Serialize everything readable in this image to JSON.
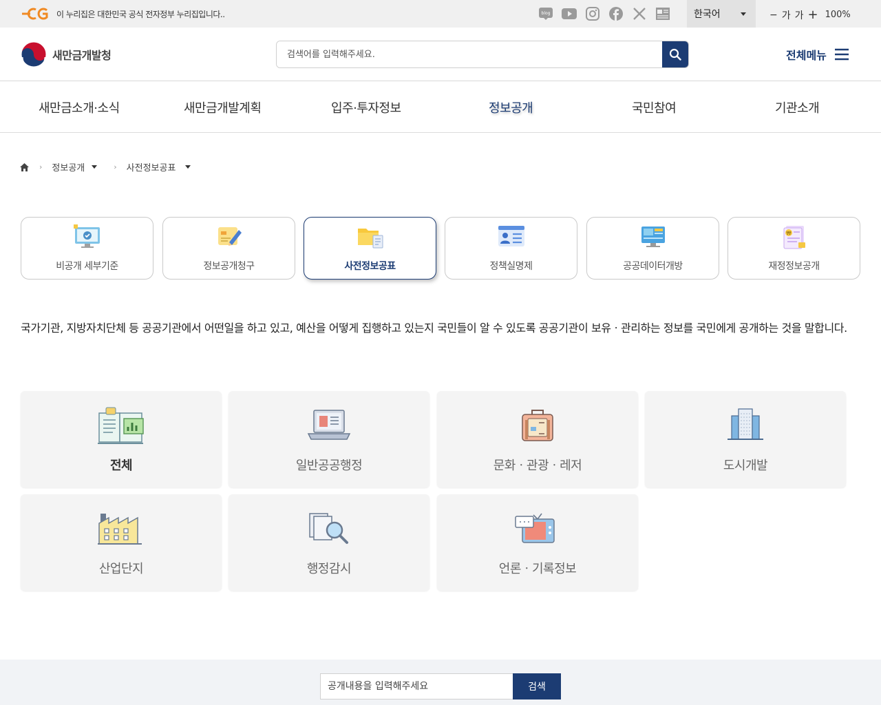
{
  "govbar": {
    "logo_text": "eG",
    "notice": "이 누리집은 대한민국 공식 전자정부 누리집입니다..",
    "sns": [
      {
        "name": "blog-icon",
        "label": "blog"
      },
      {
        "name": "youtube-icon",
        "label": "▶"
      },
      {
        "name": "instagram-icon",
        "label": "◎"
      },
      {
        "name": "facebook-icon",
        "label": "f"
      },
      {
        "name": "x-icon",
        "label": "X"
      },
      {
        "name": "newspaper-icon",
        "label": "▤"
      }
    ],
    "language": "한국어",
    "font_minus": "−",
    "font_small": "가",
    "font_large": "가",
    "font_plus": "+",
    "zoom": "100%"
  },
  "header": {
    "logo_text": "새만금개발청",
    "search_placeholder": "검색어를 입력해주세요.",
    "all_menu": "전체메뉴"
  },
  "gnb": [
    {
      "label": "새만금소개·소식",
      "active": false
    },
    {
      "label": "새만금개발계획",
      "active": false
    },
    {
      "label": "입주·투자정보",
      "active": false
    },
    {
      "label": "정보공개",
      "active": true
    },
    {
      "label": "국민참여",
      "active": false
    },
    {
      "label": "기관소개",
      "active": false
    }
  ],
  "breadcrumb": {
    "level1": "정보공개",
    "level2": "사전정보공표"
  },
  "category_tabs": [
    {
      "label": "비공개 세부기준",
      "icon": "monitor-check-icon",
      "active": false
    },
    {
      "label": "정보공개청구",
      "icon": "pen-note-icon",
      "active": false
    },
    {
      "label": "사전정보공표",
      "icon": "folder-document-icon",
      "active": true
    },
    {
      "label": "정책실명제",
      "icon": "profile-list-icon",
      "active": false
    },
    {
      "label": "공공데이터개방",
      "icon": "data-screen-icon",
      "active": false
    },
    {
      "label": "재정정보공개",
      "icon": "finance-document-icon",
      "active": false
    }
  ],
  "description": "국가기관, 지방자치단체 등 공공기관에서 어떤일을 하고 있고, 예산을 어떻게 집행하고 있는지 국민들이 알 수 있도록 공공기관이 보유ㆍ관리하는 정보를 국민에게 공개하는 것을 말합니다.",
  "categories": [
    {
      "label": "전체",
      "icon": "book-chart-icon",
      "active": true
    },
    {
      "label": "일반공공행정",
      "icon": "laptop-icon",
      "active": false
    },
    {
      "label": "문화ㆍ관광ㆍ레저",
      "icon": "suitcase-icon",
      "active": false
    },
    {
      "label": "도시개발",
      "icon": "building-icon",
      "active": false
    },
    {
      "label": "산업단지",
      "icon": "factory-icon",
      "active": false
    },
    {
      "label": "행정감시",
      "icon": "magnifier-documents-icon",
      "active": false
    },
    {
      "label": "언론ㆍ기록정보",
      "icon": "tv-speech-icon",
      "active": false
    }
  ],
  "footer_search": {
    "placeholder": "공개내용을 입력해주세요",
    "button": "검색"
  },
  "colors": {
    "primary": "#1c3c73",
    "govbar_bg": "#f0f0f0",
    "card_bg": "#f4f4f4",
    "footer_bg": "#f1f3f6"
  }
}
